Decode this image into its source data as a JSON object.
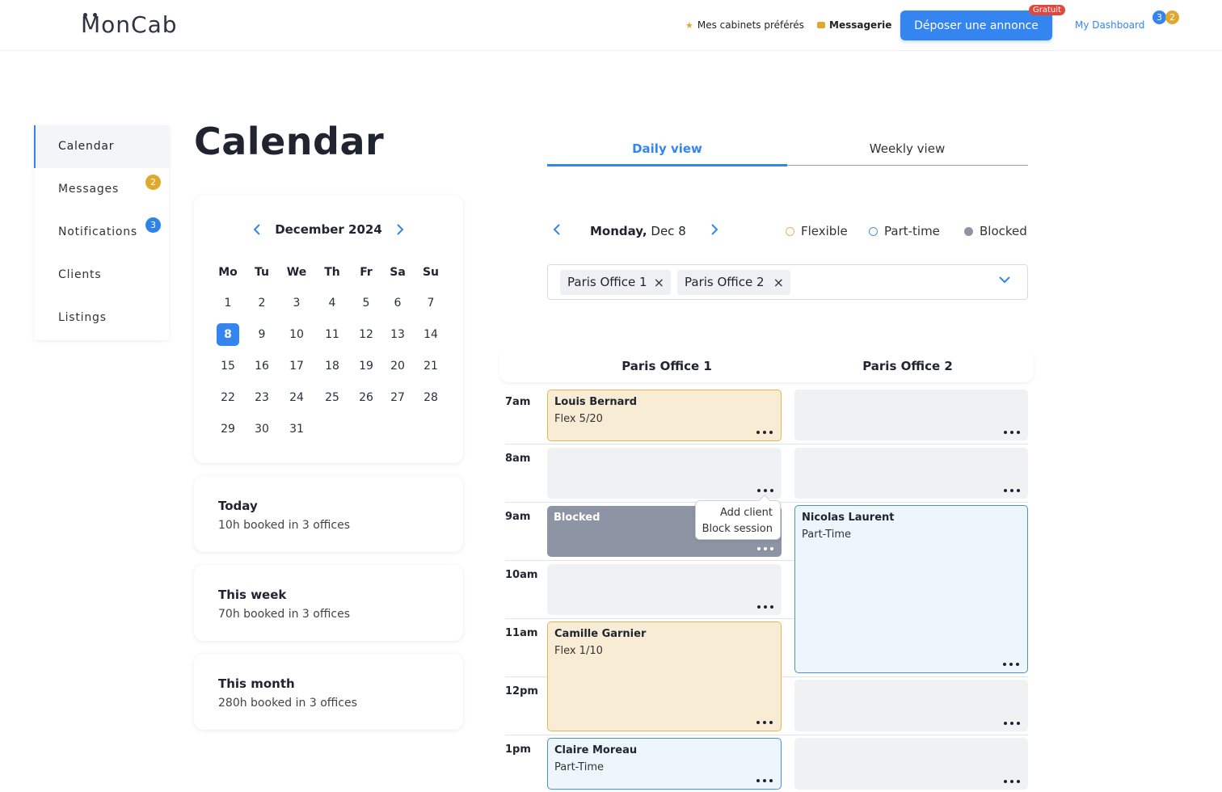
{
  "header": {
    "logo": "MonCab",
    "favorites_label": "Mes cabinets préférés",
    "messaging_label": "Messagerie",
    "post_button": "Déposer une annonce",
    "post_badge": "Gratuit",
    "dashboard_label": "My Dashboard",
    "dashboard_badge_1": "3",
    "dashboard_badge_2": "2",
    "accent_color": "#3485f0"
  },
  "sidebar": {
    "items": [
      {
        "label": "Calendar",
        "active": true
      },
      {
        "label": "Messages",
        "badge": "2"
      },
      {
        "label": "Notifications",
        "badge": "3"
      },
      {
        "label": "Clients"
      },
      {
        "label": "Listings"
      }
    ]
  },
  "page": {
    "title": "Calendar"
  },
  "minical": {
    "month_label": "December 2024",
    "weekdays": [
      "Mo",
      "Tu",
      "We",
      "Th",
      "Fr",
      "Sa",
      "Su"
    ],
    "days": [
      "1",
      "2",
      "3",
      "4",
      "5",
      "6",
      "7",
      "8",
      "9",
      "10",
      "11",
      "12",
      "13",
      "14",
      "15",
      "16",
      "17",
      "18",
      "19",
      "20",
      "21",
      "22",
      "23",
      "24",
      "25",
      "26",
      "27",
      "28",
      "29",
      "30",
      "31"
    ],
    "selected_day": "8"
  },
  "stats": [
    {
      "title": "Today",
      "text": "10h booked in 3 offices"
    },
    {
      "title": "This week",
      "text": "70h booked in 3 offices"
    },
    {
      "title": "This month",
      "text": "280h booked in 3 offices"
    }
  ],
  "tabs": {
    "daily": "Daily view",
    "weekly": "Weekly view"
  },
  "daynav": {
    "weekday": "Monday,",
    "date": "Dec 8"
  },
  "legend": {
    "flexible": "Flexible",
    "part_time": "Part-time",
    "blocked": "Blocked",
    "flexible_color": "#e6b457",
    "part_time_color": "#4b90dc",
    "blocked_color": "#8d95a5"
  },
  "selector": {
    "chips": [
      "Paris Office 1",
      "Paris Office 2"
    ]
  },
  "schedule": {
    "columns": [
      "Paris Office 1",
      "Paris Office 2"
    ],
    "hours": [
      "7am",
      "8am",
      "9am",
      "10am",
      "11am",
      "12pm",
      "1pm"
    ],
    "office1": {
      "louis": {
        "name": "Louis Bernard",
        "sub": "Flex 5/20"
      },
      "blocked": {
        "name": "Blocked"
      },
      "camille": {
        "name": "Camille Garnier",
        "sub": "Flex 1/10"
      },
      "claire": {
        "name": "Claire Moreau",
        "sub": "Part-Time"
      }
    },
    "office2": {
      "nicolas": {
        "name": "Nicolas Laurent",
        "sub": "Part-Time"
      }
    },
    "menu": {
      "add_client": "Add client",
      "block_session": "Block session"
    }
  }
}
